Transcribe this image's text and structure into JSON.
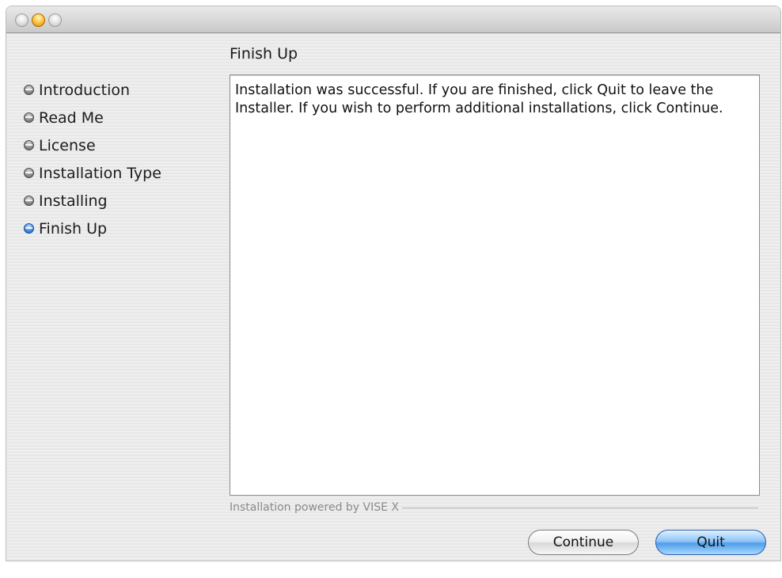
{
  "window": {
    "traffic_lights": [
      "close",
      "minimize",
      "zoom"
    ]
  },
  "panel": {
    "title": "Finish Up"
  },
  "sidebar": {
    "items": [
      {
        "label": "Introduction",
        "active": false
      },
      {
        "label": "Read Me",
        "active": false
      },
      {
        "label": "License",
        "active": false
      },
      {
        "label": "Installation Type",
        "active": false
      },
      {
        "label": "Installing",
        "active": false
      },
      {
        "label": "Finish Up",
        "active": true
      }
    ]
  },
  "content": {
    "message": "Installation was successful. If you are finished, click Quit to leave the Installer. If you wish to perform additional installations, click Continue."
  },
  "footer": {
    "powered_by": "Installation powered by VISE X"
  },
  "buttons": {
    "continue_label": "Continue",
    "quit_label": "Quit"
  },
  "colors": {
    "active_bullet": "#4a8fe0",
    "inactive_bullet": "#8d8d8d",
    "default_button": "#4f9ee8"
  }
}
